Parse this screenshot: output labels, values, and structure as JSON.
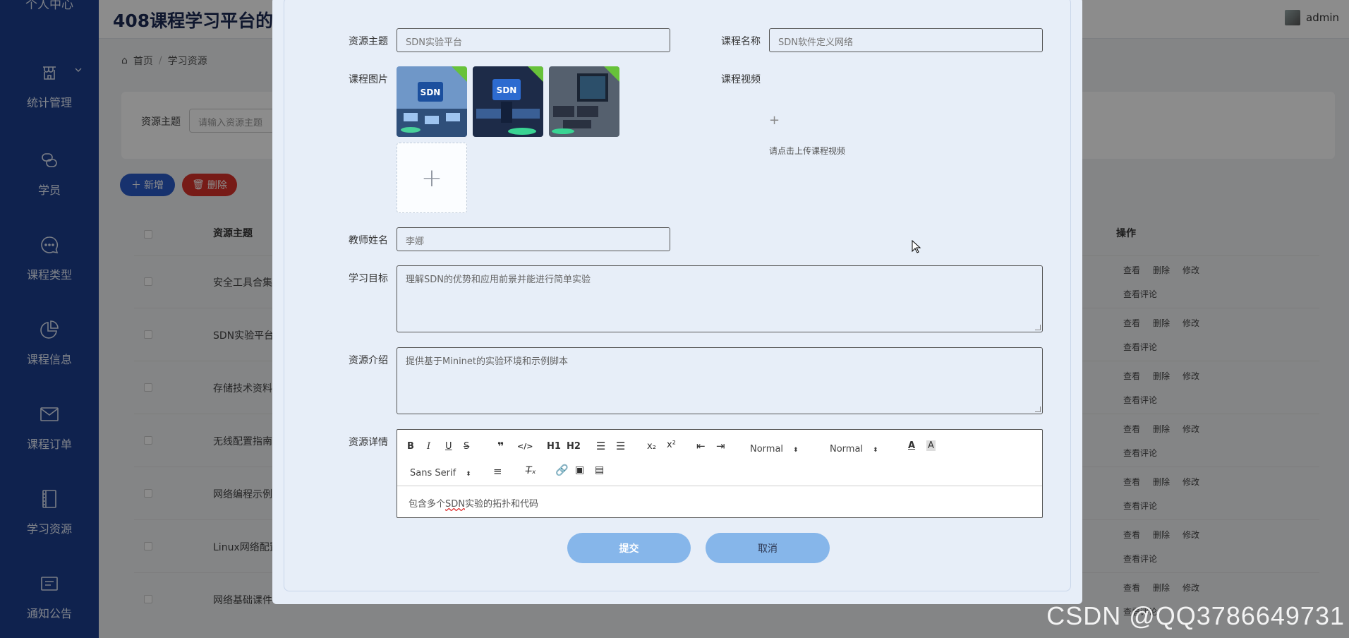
{
  "header": {
    "title": "408课程学习平台的",
    "user": "admin"
  },
  "sidebar": {
    "top_label": "个人中心",
    "items": [
      {
        "label": "统计管理",
        "icon": "shop-icon"
      },
      {
        "label": "学员",
        "icon": "link-icon"
      },
      {
        "label": "课程类型",
        "icon": "chat-icon"
      },
      {
        "label": "课程信息",
        "icon": "pie-chart-icon"
      },
      {
        "label": "课程订单",
        "icon": "mail-icon"
      },
      {
        "label": "学习资源",
        "icon": "notebook-icon"
      },
      {
        "label": "通知公告",
        "icon": "message-icon"
      }
    ]
  },
  "breadcrumb": {
    "home": "首页",
    "current": "学习资源"
  },
  "search": {
    "label": "资源主题",
    "placeholder": "请输入资源主题"
  },
  "actions": {
    "add": "新增",
    "delete": "删除"
  },
  "table": {
    "headers": {
      "theme": "资源主题",
      "ops": "操作"
    },
    "rows": [
      {
        "theme": "安全工具合集"
      },
      {
        "theme": "SDN实验平台"
      },
      {
        "theme": "存储技术资料"
      },
      {
        "theme": "无线配置指南"
      },
      {
        "theme": "网络编程示例"
      },
      {
        "theme": "Linux网络配置"
      },
      {
        "theme": "网络基础课件"
      }
    ],
    "ops": {
      "view": "查看",
      "delete": "删除",
      "edit": "修改",
      "comments": "查看评论"
    }
  },
  "form": {
    "theme_label": "资源主题",
    "theme_value": "SDN实验平台",
    "course_name_label": "课程名称",
    "course_name_value": "SDN软件定义网络",
    "course_image_label": "课程图片",
    "course_video_label": "课程视频",
    "video_upload_hint": "请点击上传课程视频",
    "teacher_label": "教师姓名",
    "teacher_value": "李娜",
    "goal_label": "学习目标",
    "goal_value": "理解SDN的优势和应用前景并能进行简单实验",
    "intro_label": "资源介绍",
    "intro_value": "提供基于Mininet的实验环境和示例脚本",
    "detail_label": "资源详情",
    "detail_prefix": "包含多个",
    "detail_marked": "SDN",
    "detail_suffix": "实验的拓扑和代码",
    "editor": {
      "size_select": "Normal",
      "header_select": "Normal",
      "font_select": "Sans Serif",
      "h1": "H1",
      "h2": "H2"
    },
    "submit": "提交",
    "cancel": "取消"
  },
  "watermark": "CSDN @QQ3786649731",
  "colors": {
    "sidebar": "#1d3f8f",
    "primary": "#2b5bc9",
    "danger": "#d9322b",
    "modal_button": "#86b6ea"
  }
}
